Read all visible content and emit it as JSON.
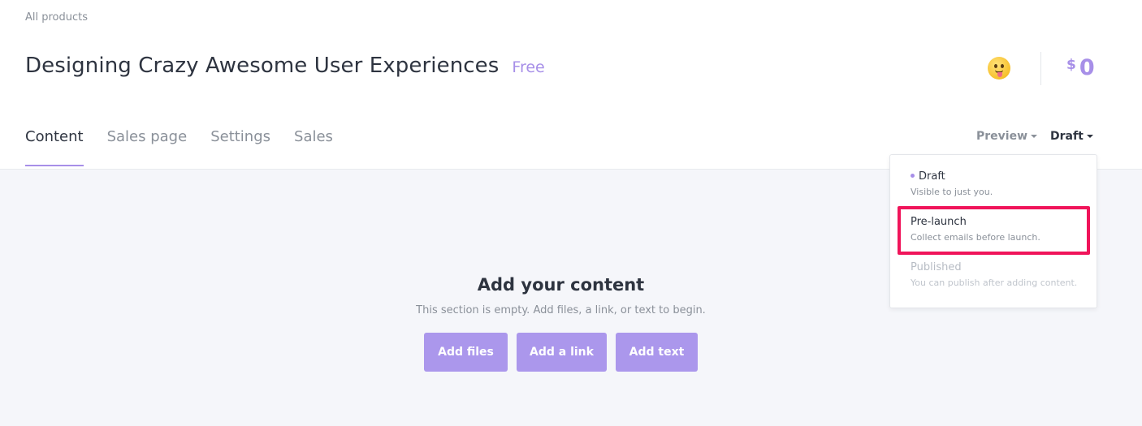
{
  "breadcrumb": "All products",
  "product": {
    "title": "Designing Crazy Awesome User Experiences",
    "price_tag": "Free"
  },
  "header": {
    "avatar_icon": "tongue-out-emoji-icon",
    "currency": "$",
    "balance": "0"
  },
  "tabs": [
    {
      "label": "Content",
      "active": true
    },
    {
      "label": "Sales page",
      "active": false
    },
    {
      "label": "Settings",
      "active": false
    },
    {
      "label": "Sales",
      "active": false
    }
  ],
  "toolbar": {
    "preview_label": "Preview",
    "status_label": "Draft"
  },
  "status_dropdown": {
    "options": [
      {
        "label": "Draft",
        "description": "Visible to just you.",
        "selected": true,
        "disabled": false
      },
      {
        "label": "Pre-launch",
        "description": "Collect emails before launch.",
        "selected": false,
        "disabled": false,
        "highlighted": true
      },
      {
        "label": "Published",
        "description": "You can publish after adding content.",
        "selected": false,
        "disabled": true
      }
    ]
  },
  "content": {
    "empty_title": "Add your content",
    "empty_description": "This section is empty. Add files, a link, or text to begin.",
    "actions": {
      "add_files": "Add files",
      "add_link": "Add a link",
      "add_text": "Add text"
    }
  },
  "colors": {
    "accent": "#a78fe8",
    "button": "#ab97ec",
    "highlight": "#f0145a",
    "background": "#f5f6fa"
  }
}
